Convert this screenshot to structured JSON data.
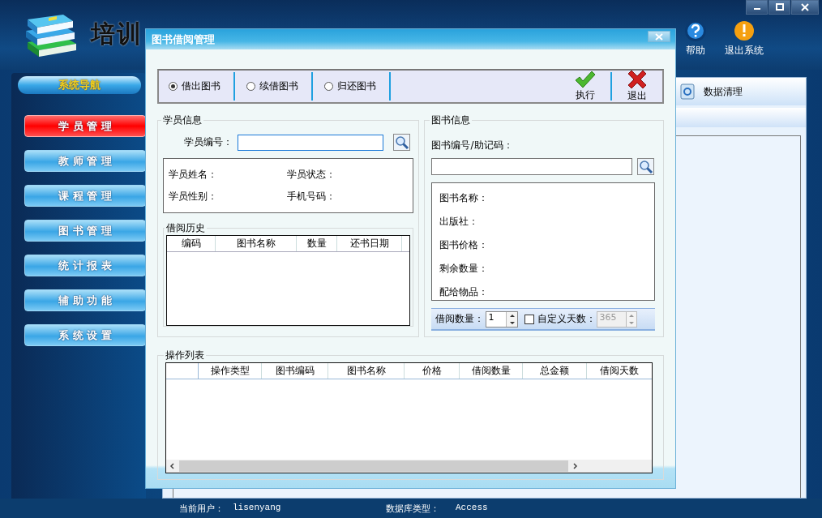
{
  "app": {
    "title": "培训"
  },
  "window_controls": [
    {
      "kind": "minimize"
    },
    {
      "kind": "maximize"
    },
    {
      "kind": "close"
    }
  ],
  "toolbar": [
    {
      "label": "帮助",
      "kind": "help"
    },
    {
      "label": "退出系统",
      "kind": "exit"
    }
  ],
  "nav": {
    "title": "系统导航",
    "items": [
      {
        "label": "学 员 管 理",
        "selected": true
      },
      {
        "label": "教 师 管 理",
        "selected": false
      },
      {
        "label": "课 程 管 理",
        "selected": false
      },
      {
        "label": "图 书 管 理",
        "selected": false
      },
      {
        "label": "统 计 报 表",
        "selected": false
      },
      {
        "label": "辅 助 功 能",
        "selected": false
      },
      {
        "label": "系 统 设 置",
        "selected": false
      }
    ]
  },
  "content_tab": {
    "label": "数据清理"
  },
  "status_bar": {
    "user_label": "当前用户：",
    "user": "lisenyang",
    "db_label": "数据库类型：",
    "db": "Access"
  },
  "dialog": {
    "title": "图书借阅管理",
    "modes": [
      {
        "label": "借出图书",
        "selected": true
      },
      {
        "label": "续借图书",
        "selected": false
      },
      {
        "label": "归还图书",
        "selected": false
      }
    ],
    "actions": [
      {
        "label": "执行",
        "kind": "execute"
      },
      {
        "label": "退出",
        "kind": "exit"
      }
    ],
    "student": {
      "title": "学员信息",
      "id_label": "学员编号：",
      "fields": [
        "学员姓名：",
        "学员状态：",
        "学员性别：",
        "手机号码："
      ]
    },
    "history": {
      "title": "借阅历史",
      "columns": [
        "编码",
        "图书名称",
        "数量",
        "还书日期"
      ]
    },
    "book": {
      "title": "图书信息",
      "id_label": "图书编号/助记码：",
      "fields": [
        "图书名称：",
        "出版社：",
        "图书价格：",
        "剩余数量：",
        "配给物品："
      ]
    },
    "borrow_count": {
      "label": "借阅数量：",
      "value": "1"
    },
    "custom_days": {
      "label": "自定义天数：",
      "checked": false,
      "value": "365",
      "disabled": true
    },
    "operations": {
      "title": "操作列表",
      "columns": [
        "操作类型",
        "图书编码",
        "图书名称",
        "价格",
        "借阅数量",
        "总金额",
        "借阅天数"
      ]
    }
  }
}
